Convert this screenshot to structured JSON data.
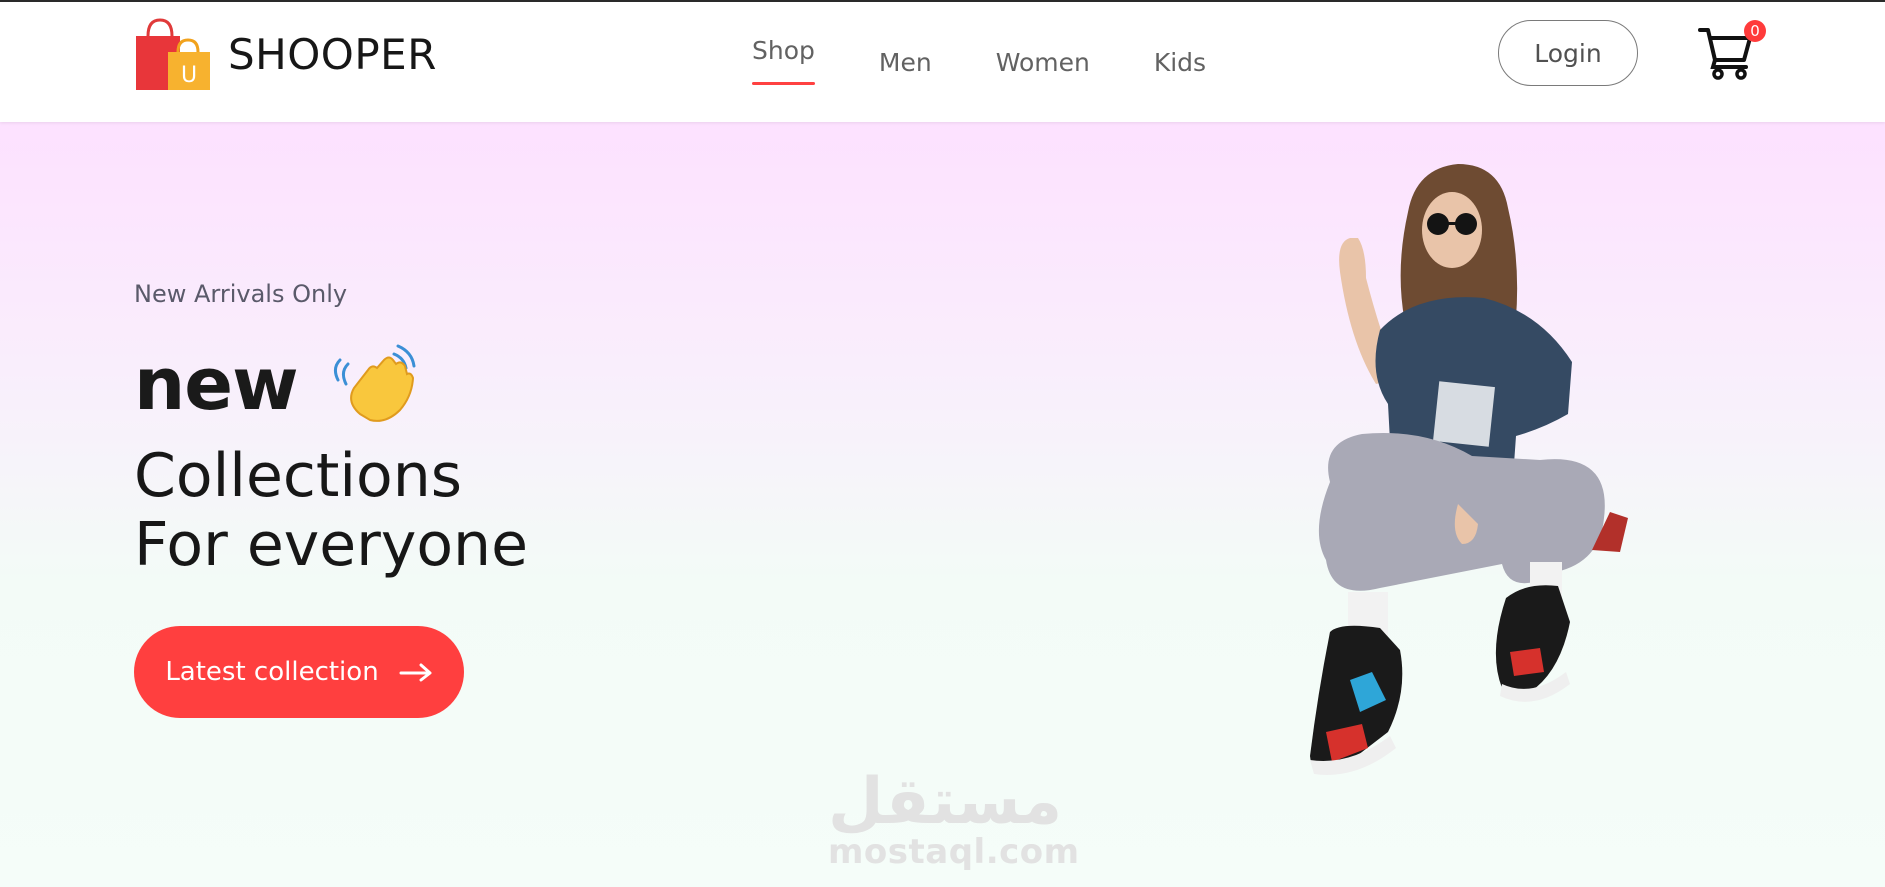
{
  "brand": {
    "name": "SHOOPER",
    "logo_letter": "U"
  },
  "nav": {
    "items": [
      {
        "label": "Shop",
        "active": true
      },
      {
        "label": "Men",
        "active": false
      },
      {
        "label": "Women",
        "active": false
      },
      {
        "label": "Kids",
        "active": false
      }
    ]
  },
  "header": {
    "login_label": "Login",
    "cart_count": "0"
  },
  "hero": {
    "tagline": "New Arrivals Only",
    "headline_word": "new",
    "line1": "Collections",
    "line2": "For everyone",
    "cta_label": "Latest collection"
  },
  "watermark": {
    "arabic": "مستقل",
    "latin": "mostaql.com"
  },
  "colors": {
    "accent": "#ff4141",
    "hero_top": "#fde1ff",
    "hero_bottom": "#f5fdf9"
  },
  "icons": [
    "shopping-bag-logo-icon",
    "waving-hand-icon",
    "cart-icon",
    "arrow-right-icon",
    "hero-model-image"
  ]
}
